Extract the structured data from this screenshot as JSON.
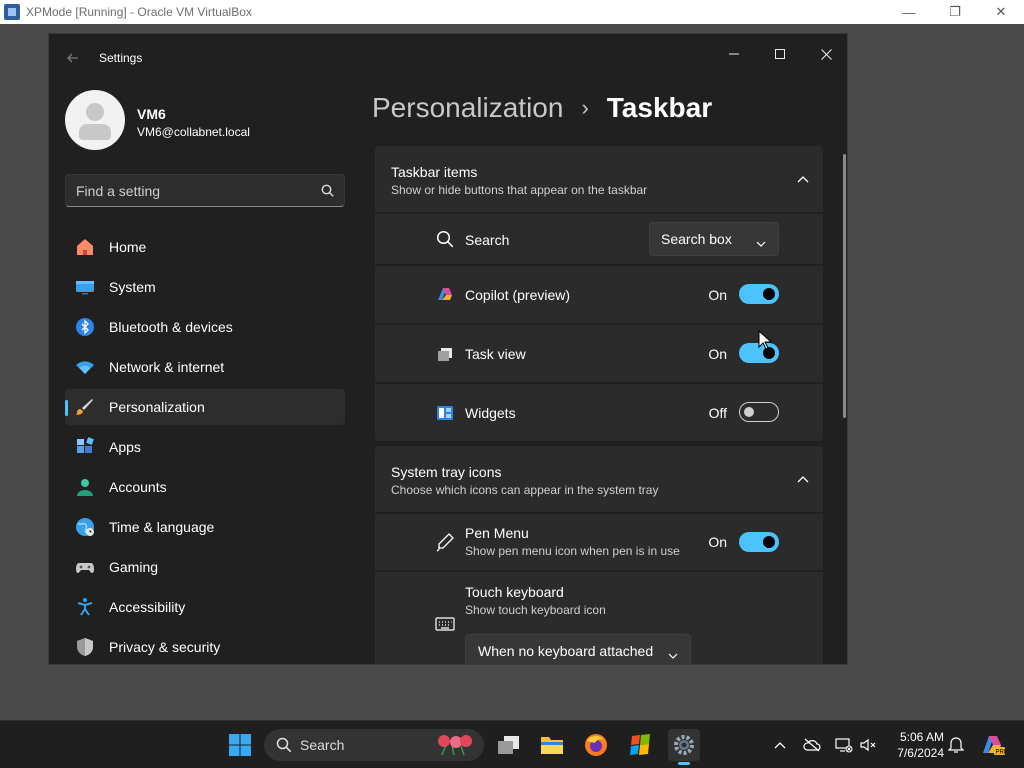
{
  "host_window": {
    "title": "XPMode [Running] - Oracle VM VirtualBox",
    "minimize": "—",
    "restore": "❐",
    "close": "✕"
  },
  "settings_window": {
    "title": "Settings",
    "minimize": "—",
    "maximize": "☐",
    "close": "✕"
  },
  "profile": {
    "name": "VM6",
    "email": "VM6@collabnet.local"
  },
  "search": {
    "placeholder": "Find a setting"
  },
  "nav": {
    "items": [
      {
        "label": "Home",
        "icon": "home-icon"
      },
      {
        "label": "System",
        "icon": "system-icon"
      },
      {
        "label": "Bluetooth & devices",
        "icon": "bluetooth-icon"
      },
      {
        "label": "Network & internet",
        "icon": "network-icon"
      },
      {
        "label": "Personalization",
        "icon": "brush-icon",
        "active": true
      },
      {
        "label": "Apps",
        "icon": "apps-icon"
      },
      {
        "label": "Accounts",
        "icon": "accounts-icon"
      },
      {
        "label": "Time & language",
        "icon": "globe-icon"
      },
      {
        "label": "Gaming",
        "icon": "gamepad-icon"
      },
      {
        "label": "Accessibility",
        "icon": "accessibility-icon"
      },
      {
        "label": "Privacy & security",
        "icon": "shield-icon"
      }
    ]
  },
  "breadcrumb": {
    "parent": "Personalization",
    "separator": "›",
    "current": "Taskbar"
  },
  "taskbar_items": {
    "title": "Taskbar items",
    "subtitle": "Show or hide buttons that appear on the taskbar",
    "search": {
      "label": "Search",
      "value": "Search box"
    },
    "copilot": {
      "label": "Copilot (preview)",
      "state": "On",
      "on": true
    },
    "task_view": {
      "label": "Task view",
      "state": "On",
      "on": true
    },
    "widgets": {
      "label": "Widgets",
      "state": "Off",
      "on": false
    }
  },
  "system_tray": {
    "title": "System tray icons",
    "subtitle": "Choose which icons can appear in the system tray",
    "pen_menu": {
      "label": "Pen Menu",
      "sub": "Show pen menu icon when pen is in use",
      "state": "On",
      "on": true
    },
    "touch_keyboard": {
      "label": "Touch keyboard",
      "sub": "Show touch keyboard icon",
      "value": "When no keyboard attached"
    }
  },
  "taskbar": {
    "search_label": "Search",
    "time": "5:06 AM",
    "date": "7/6/2024"
  },
  "colors": {
    "accent": "#4cc2ff",
    "window_bg": "#202020",
    "card_bg": "#2b2b2b",
    "taskbar_bg": "#1f1f1f"
  }
}
